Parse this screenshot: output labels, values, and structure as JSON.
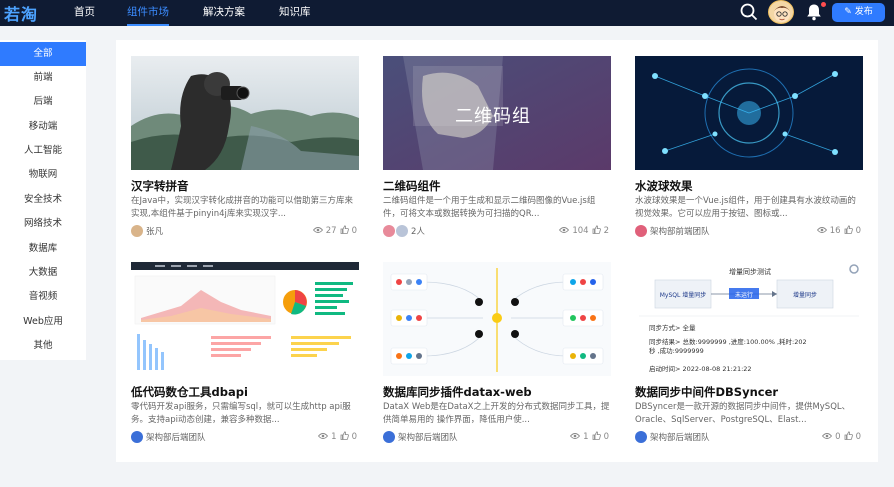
{
  "brand": {
    "logo": "若淘"
  },
  "nav": [
    {
      "label": "首页",
      "active": false
    },
    {
      "label": "组件市场",
      "active": true
    },
    {
      "label": "解决方案",
      "active": false
    },
    {
      "label": "知识库",
      "active": false
    }
  ],
  "header": {
    "publish_label": "发布",
    "accent": "#2f7bff"
  },
  "sidebar": {
    "items": [
      "全部",
      "前端",
      "后端",
      "移动端",
      "人工智能",
      "物联网",
      "安全技术",
      "网络技术",
      "数据库",
      "大数据",
      "音视频",
      "Web应用",
      "其他"
    ],
    "active": "全部"
  },
  "cards": [
    {
      "title": "汉字转拼音",
      "desc": "在Java中，实现汉字转化成拼音的功能可以借助第三方库来实现,本组件基于pinyin4j库来实现汉字...",
      "author": "张凡",
      "views": "27",
      "likes": "0",
      "image": "photographer-mountains",
      "image_text": ""
    },
    {
      "title": "二维码组件",
      "desc": "二维码组件是一个用于生成和显示二维码图像的Vue.js组件，可将文本或数据转换为可扫描的QR...",
      "author": "2人",
      "views": "104",
      "likes": "2",
      "image": "qr-hand",
      "image_text": "二维码组"
    },
    {
      "title": "水波球效果",
      "desc": "水波球效果是一个Vue.js组件，用于创建具有水波纹动画的视觉效果。它可以应用于按钮、图标或...",
      "author": "架构部前端团队",
      "views": "16",
      "likes": "0",
      "image": "tech-network",
      "image_text": ""
    },
    {
      "title": "低代码数仓工具dbapi",
      "desc": "零代码开发api服务，只需编写sql，就可以生成http api服务。支持api动态创建，兼容多种数据...",
      "author": "架构部后端团队",
      "views": "1",
      "likes": "0",
      "image": "dashboard",
      "image_text": ""
    },
    {
      "title": "数据库同步插件datax-web",
      "desc": "DataX Web是在DataX之上开发的分布式数据同步工具，提供简单易用的 操作界面，降低用户使...",
      "author": "架构部后端团队",
      "views": "1",
      "likes": "0",
      "image": "datax-diagram",
      "image_text": ""
    },
    {
      "title": "数据同步中间件DBSyncer",
      "desc": "DBSyncer是一款开源的数据同步中间件，提供MySQL、Oracle、SqlServer、PostgreSQL、Elast...",
      "author": "架构部后端团队",
      "views": "0",
      "likes": "0",
      "image": "sync-screenshot",
      "image_text": ""
    }
  ],
  "sync_shot": {
    "title": "增量同步测试",
    "left_box": "MySQL 增量同步",
    "mid_label": "未运行",
    "right_box": "增量同步",
    "line1": "同步方式> 全量",
    "line2": "同步结果> 总数:9999999 ,进度:100.00% ,耗时:202秒 ,成功:9999999",
    "line3": "启动时间> 2022-08-08 21:21:22"
  }
}
